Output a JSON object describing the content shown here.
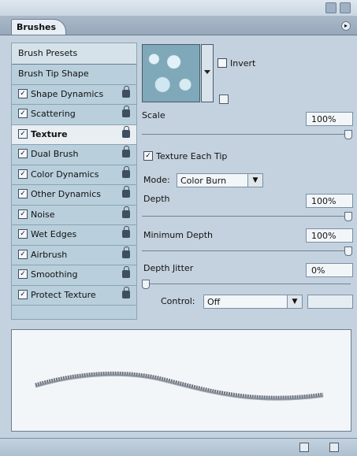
{
  "window": {
    "tab_label": "Brushes"
  },
  "sidebar": {
    "header": "Brush Presets",
    "items": [
      {
        "label": "Brush Tip Shape",
        "checkbox": false,
        "checked": false,
        "lock": false,
        "selected": false
      },
      {
        "label": "Shape Dynamics",
        "checkbox": true,
        "checked": true,
        "lock": true,
        "selected": false
      },
      {
        "label": "Scattering",
        "checkbox": true,
        "checked": true,
        "lock": true,
        "selected": false
      },
      {
        "label": "Texture",
        "checkbox": true,
        "checked": true,
        "lock": true,
        "selected": true
      },
      {
        "label": "Dual Brush",
        "checkbox": true,
        "checked": true,
        "lock": true,
        "selected": false
      },
      {
        "label": "Color Dynamics",
        "checkbox": true,
        "checked": true,
        "lock": true,
        "selected": false
      },
      {
        "label": "Other Dynamics",
        "checkbox": true,
        "checked": true,
        "lock": true,
        "selected": false
      },
      {
        "label": "Noise",
        "checkbox": true,
        "checked": true,
        "lock": true,
        "selected": false
      },
      {
        "label": "Wet Edges",
        "checkbox": true,
        "checked": true,
        "lock": true,
        "selected": false
      },
      {
        "label": "Airbrush",
        "checkbox": true,
        "checked": true,
        "lock": true,
        "selected": false
      },
      {
        "label": "Smoothing",
        "checkbox": true,
        "checked": true,
        "lock": true,
        "selected": false
      },
      {
        "label": "Protect Texture",
        "checkbox": true,
        "checked": true,
        "lock": true,
        "selected": false
      }
    ]
  },
  "texture": {
    "invert_label": "Invert",
    "invert_checked": false,
    "scale_label": "Scale",
    "scale_value": "100%",
    "scale_level": 1.0,
    "texture_each_tip_label": "Texture Each Tip",
    "texture_each_tip_checked": true,
    "mode_label": "Mode:",
    "mode_value": "Color Burn",
    "depth_label": "Depth",
    "depth_value": "100%",
    "depth_level": 1.0,
    "min_depth_label": "Minimum Depth",
    "min_depth_value": "100%",
    "min_depth_level": 1.0,
    "depth_jitter_label": "Depth Jitter",
    "depth_jitter_value": "0%",
    "depth_jitter_level": 0.0,
    "control_label": "Control:",
    "control_value": "Off"
  }
}
